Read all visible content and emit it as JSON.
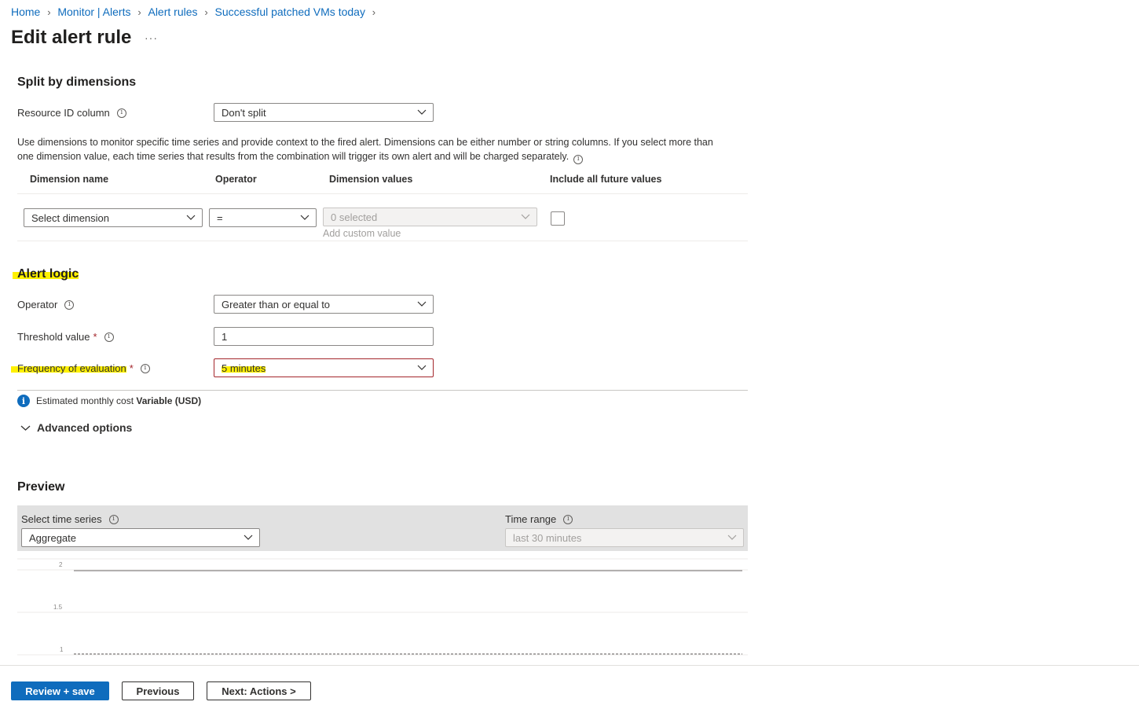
{
  "breadcrumb": [
    "Home",
    "Monitor | Alerts",
    "Alert rules",
    "Successful patched VMs today"
  ],
  "page_title": "Edit alert rule",
  "more_label": "···",
  "split": {
    "title": "Split by dimensions",
    "resource_id_label": "Resource ID column",
    "resource_id_value": "Don't split",
    "description": "Use dimensions to monitor specific time series and provide context to the fired alert. Dimensions can be either number or string columns. If you select more than one dimension value, each time series that results from the combination will trigger its own alert and will be charged separately.",
    "columns": [
      "Dimension name",
      "Operator",
      "Dimension values",
      "Include all future values"
    ],
    "row": {
      "dimension": "Select dimension",
      "operator": "=",
      "values": "0 selected",
      "add_custom": "Add custom value"
    }
  },
  "logic": {
    "title": "Alert logic",
    "operator_label": "Operator",
    "operator_value": "Greater than or equal to",
    "threshold_label": "Threshold value",
    "threshold_value": "1",
    "frequency_label": "Frequency of evaluation",
    "frequency_value": "5 minutes",
    "required_mark": "*",
    "cost_prefix": "Estimated monthly cost",
    "cost_value": "Variable (USD)",
    "advanced": "Advanced options"
  },
  "preview": {
    "title": "Preview",
    "series_label": "Select time series",
    "series_value": "Aggregate",
    "range_label": "Time range",
    "range_value": "last 30 minutes",
    "yticks": [
      "2",
      "1.5",
      "1"
    ]
  },
  "footer": {
    "review": "Review + save",
    "previous": "Previous",
    "next": "Next: Actions >"
  },
  "colors": {
    "accent": "#0f6cbd",
    "error_border": "#a4262c",
    "highlight": "#fff100"
  }
}
